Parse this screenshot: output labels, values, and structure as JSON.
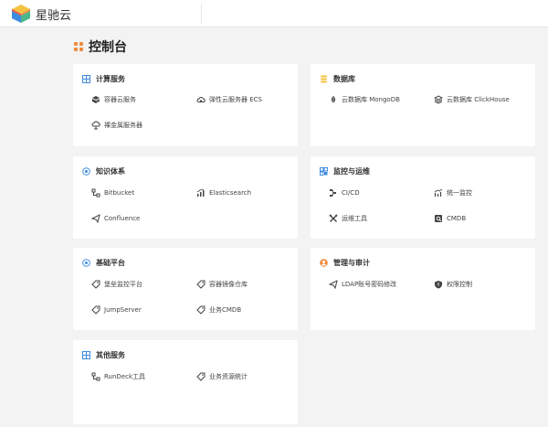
{
  "brand": {
    "name": "星驰云"
  },
  "page": {
    "title": "控制台"
  },
  "cards": {
    "compute": {
      "title": "计算服务",
      "items": [
        "容器云服务",
        "弹性云服务器 ECS",
        "裸金属服务器"
      ]
    },
    "database": {
      "title": "数据库",
      "items": [
        "云数据库 MongoDB",
        "云数据库 ClickHouse"
      ]
    },
    "knowledge": {
      "title": "知识体系",
      "items": [
        "Bitbucket",
        "Elasticsearch",
        "Confluence"
      ]
    },
    "ops": {
      "title": "监控与运维",
      "items": [
        "CI/CD",
        "统一监控",
        "运维工具",
        "CMDB"
      ]
    },
    "platform": {
      "title": "基础平台",
      "items": [
        "堡垒监控平台",
        "容器镜像仓库",
        "JumpServer",
        "业务CMDB"
      ]
    },
    "audit": {
      "title": "管理与审计",
      "items": [
        "LDAP账号密码修改",
        "权限控制"
      ]
    },
    "other": {
      "title": "其他服务",
      "items": [
        "RunDeck工具",
        "业务资源统计"
      ]
    }
  },
  "colors": {
    "accent_blue": "#3d8be0",
    "accent_orange": "#f08a3c",
    "accent_yellow": "#f5c242"
  }
}
